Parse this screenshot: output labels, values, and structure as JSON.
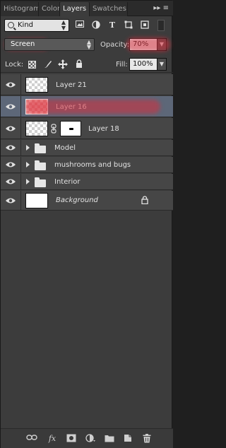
{
  "tabs": [
    {
      "label": "Histogram",
      "active": false
    },
    {
      "label": "Color",
      "active": false
    },
    {
      "label": "Layers",
      "active": true
    },
    {
      "label": "Swatches",
      "active": false
    }
  ],
  "tab_menu_glyph": "▸▸ ≡",
  "filter": {
    "kind_label": "Kind",
    "icons": [
      "image-filter-icon",
      "adjustment-filter-icon",
      "type-filter-icon",
      "shape-filter-icon",
      "smart-object-filter-icon"
    ]
  },
  "blend": {
    "mode": "Screen",
    "opacity_label": "Opacity:",
    "opacity_value": "70%"
  },
  "lock": {
    "label": "Lock:",
    "fill_label": "Fill:",
    "fill_value": "100%"
  },
  "layers": [
    {
      "name": "Layer 21",
      "type": "pixel",
      "selected": false,
      "visible": true
    },
    {
      "name": "Layer 16",
      "type": "pixel",
      "selected": true,
      "visible": true
    },
    {
      "name": "Layer 18",
      "type": "masked",
      "selected": false,
      "visible": true
    },
    {
      "name": "Model",
      "type": "group",
      "selected": false,
      "visible": true
    },
    {
      "name": "mushrooms and bugs",
      "type": "group",
      "selected": false,
      "visible": true
    },
    {
      "name": "Interior",
      "type": "group",
      "selected": false,
      "visible": true
    },
    {
      "name": "Background",
      "type": "background",
      "selected": false,
      "visible": true,
      "locked": true
    }
  ],
  "bottom_bar": {
    "fx_label": "fx"
  },
  "colors": {
    "panel_bg": "#3c3c3c",
    "selected_row": "#5d6778",
    "highlight": "#d72d3c"
  }
}
